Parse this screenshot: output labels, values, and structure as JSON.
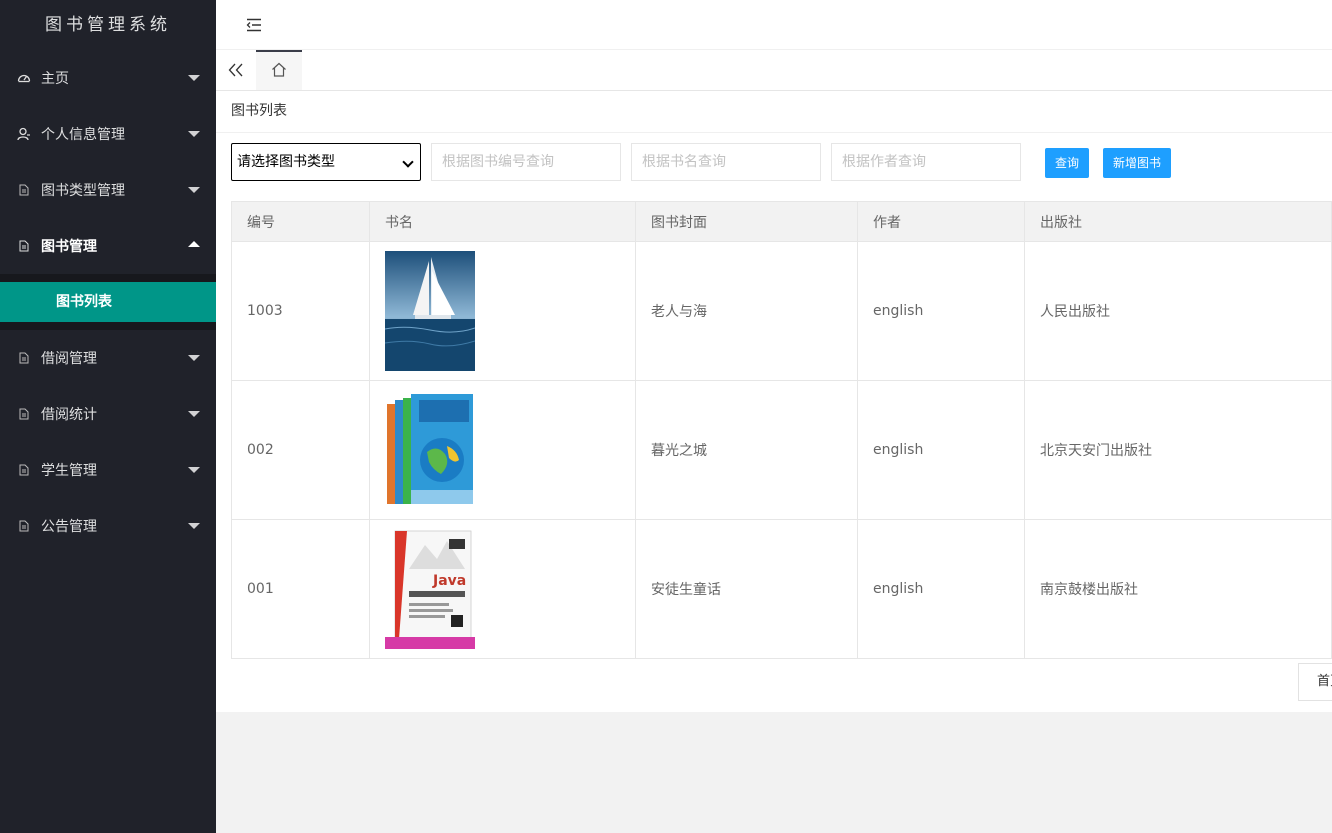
{
  "app": {
    "title": "图书管理系统"
  },
  "sidebar": {
    "items": [
      {
        "label": "主页",
        "icon": "dashboard-icon"
      },
      {
        "label": "个人信息管理",
        "icon": "user-icon"
      },
      {
        "label": "图书类型管理",
        "icon": "file-icon"
      },
      {
        "label": "图书管理",
        "icon": "file-icon",
        "open": true,
        "sub": [
          {
            "label": "图书列表",
            "active": true
          }
        ]
      },
      {
        "label": "借阅管理",
        "icon": "file-icon"
      },
      {
        "label": "借阅统计",
        "icon": "file-icon"
      },
      {
        "label": "学生管理",
        "icon": "file-icon"
      },
      {
        "label": "公告管理",
        "icon": "file-icon"
      }
    ]
  },
  "header": {
    "menu_icon": "menu-fold-icon"
  },
  "tabs": {
    "prev_icon": "double-chevron-left-icon",
    "home_icon": "home-icon"
  },
  "main": {
    "card_title": "图书列表",
    "search": {
      "type_select": "请选择图书类型",
      "number_placeholder": "根据图书编号查询",
      "name_placeholder": "根据书名查询",
      "author_placeholder": "根据作者查询",
      "query_button": "查询",
      "add_button": "新增图书"
    },
    "table": {
      "headers": [
        "编号",
        "书名",
        "图书封面",
        "作者",
        "出版社"
      ],
      "rows": [
        {
          "id": "1003",
          "cover": "sailboat-cover",
          "title": "老人与海",
          "author": "english",
          "publisher": "人民出版社"
        },
        {
          "id": "002",
          "cover": "globe-books-cover",
          "title": "暮光之城",
          "author": "english",
          "publisher": "北京天安门出版社"
        },
        {
          "id": "001",
          "cover": "java-book-cover",
          "title": "安徒生童话",
          "author": "english",
          "publisher": "南京鼓楼出版社"
        }
      ]
    },
    "pager": {
      "first_label": "首页"
    }
  },
  "colors": {
    "sidebar": "#20222a",
    "active": "#009688",
    "button": "#1e9fff"
  }
}
